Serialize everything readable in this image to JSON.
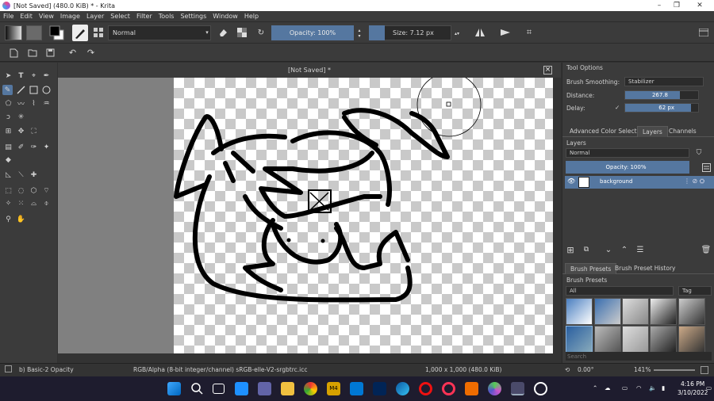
{
  "window": {
    "title": "[Not Saved]  (480.0 KiB)  * - Krita",
    "minimize_glyph": "–",
    "maximize_glyph": "❐",
    "close_glyph": "✕"
  },
  "menu": [
    "File",
    "Edit",
    "View",
    "Image",
    "Layer",
    "Select",
    "Filter",
    "Tools",
    "Settings",
    "Window",
    "Help"
  ],
  "toolbar": {
    "blend_mode": "Normal",
    "opacity_label": "Opacity: 100%",
    "size_label": "Size: 7.12 px"
  },
  "document": {
    "tab_title": "[Not Saved]  *",
    "close_glyph": "×"
  },
  "tool_options": {
    "title": "Tool Options",
    "brush_smoothing_label": "Brush Smoothing:",
    "brush_smoothing_value": "Stabilizer",
    "distance_label": "Distance:",
    "distance_value": "267.8",
    "delay_label": "Delay:",
    "delay_check": "✓",
    "delay_value": "62 px",
    "distance_fill": 0.75,
    "delay_fill": 0.9
  },
  "dock_tabs": [
    "Advanced Color Selector",
    "Layers",
    "Channels"
  ],
  "layers": {
    "title": "Layers",
    "blend_mode": "Normal",
    "opacity_label": "Opacity:  100%",
    "items": [
      {
        "name": "background"
      }
    ]
  },
  "brush_presets": {
    "tabs": [
      "Brush Presets",
      "Brush Preset History"
    ],
    "title": "Brush Presets",
    "filter_value": "All",
    "tag_label": "Tag",
    "search_placeholder": "Search"
  },
  "status": {
    "brush_name": "b) Basic-2 Opacity",
    "color_profile": "RGB/Alpha (8-bit integer/channel)  sRGB-elle-V2-srgbtrc.icc",
    "image_size": "1,000 x 1,000 (480.0 KiB)",
    "rotation": "0.00°",
    "zoom": "141%"
  },
  "clock": {
    "time": "4:16 PM",
    "date": "3/10/2022"
  },
  "colors": {
    "accent": "#5577a0",
    "panel": "#3b3b3b",
    "taskbar": "#1e1c2e"
  }
}
